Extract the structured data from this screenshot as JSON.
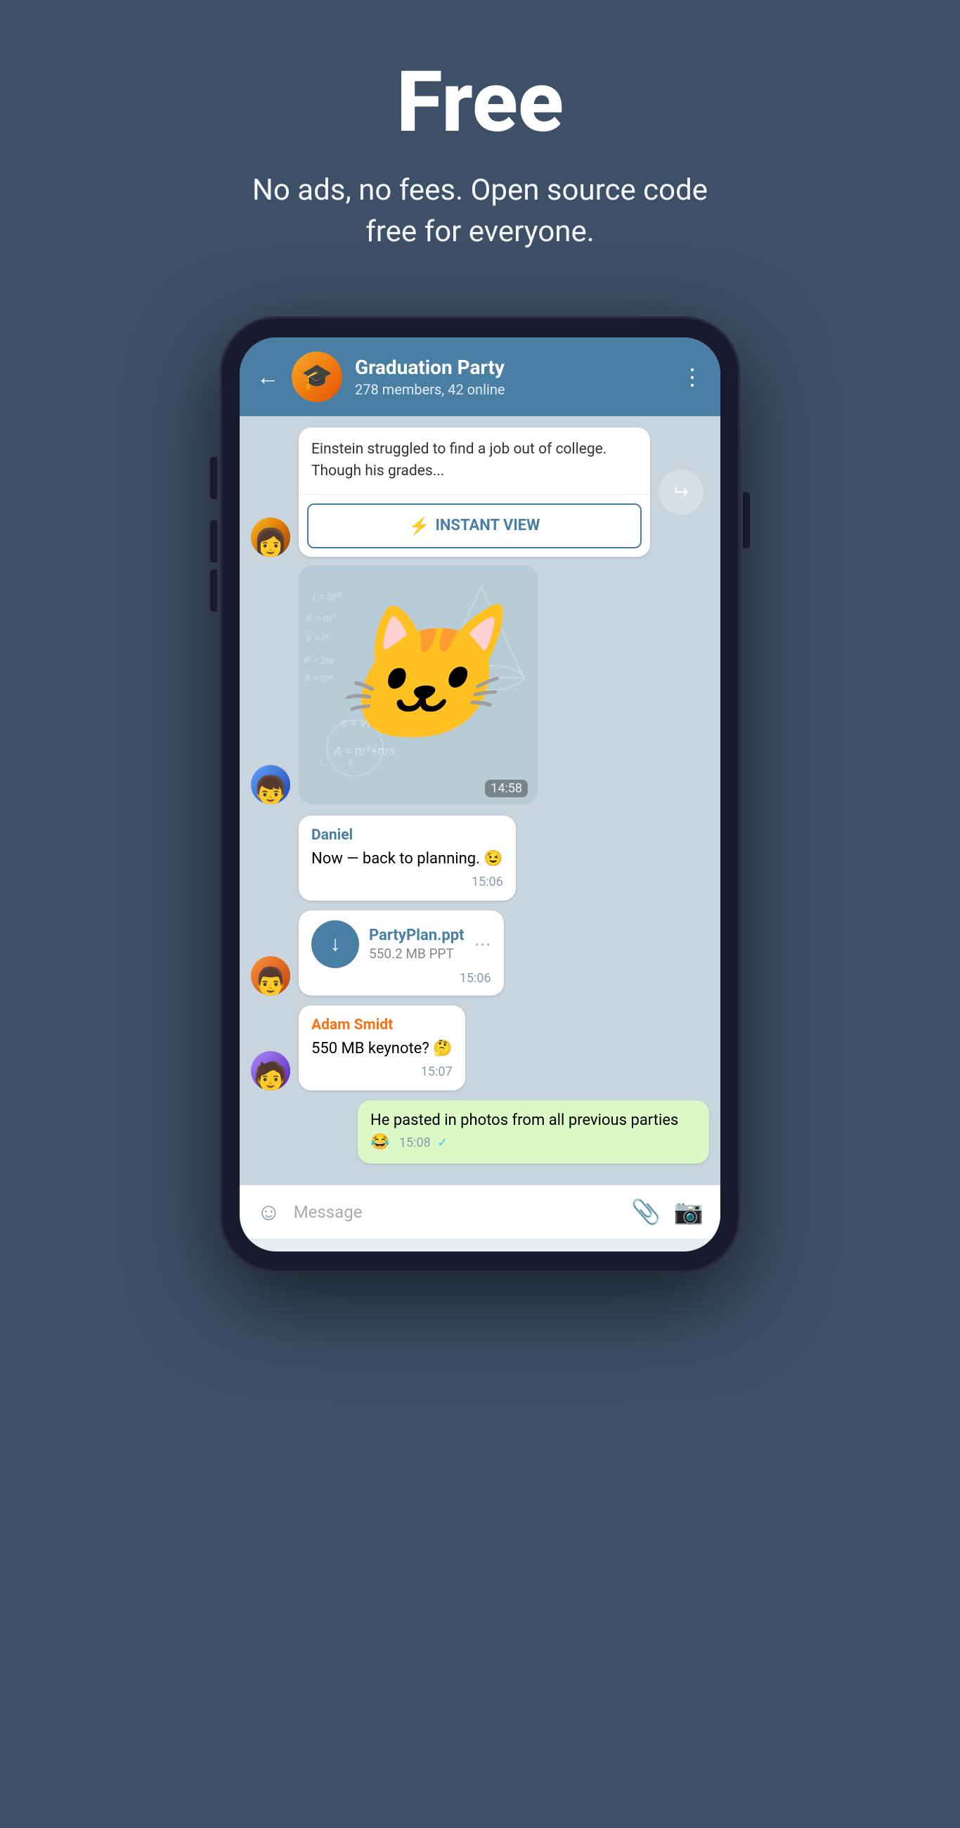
{
  "hero": {
    "title": "Free",
    "subtitle": "No ads, no fees. Open source code free for everyone."
  },
  "phone": {
    "header": {
      "back_label": "←",
      "group_name": "Graduation Party",
      "group_meta": "278 members, 42 online",
      "more_icon": "⋮"
    },
    "messages": [
      {
        "id": "msg-iv",
        "type": "instant_view",
        "avatar_class": "av-photo-amber",
        "article_text": "Einstein struggled to find a job out of college. Though his grades...",
        "iv_button_label": "INSTANT VIEW",
        "forward_icon": "↪"
      },
      {
        "id": "msg-sticker",
        "type": "sticker",
        "avatar_class": "av-photo-blue",
        "sticker_emoji": "🐱",
        "time": "14:58"
      },
      {
        "id": "msg-daniel",
        "type": "text",
        "sender": "Daniel",
        "sender_color": "blue",
        "text": "Now — back to planning. 😉",
        "time": "15:06"
      },
      {
        "id": "msg-file",
        "type": "file",
        "avatar_class": "av-photo-orange",
        "file_name": "PartyPlan.ppt",
        "file_size": "550.2 MB PPT",
        "time": "15:06",
        "download_icon": "↓"
      },
      {
        "id": "msg-adam",
        "type": "text",
        "sender": "Adam Smidt",
        "sender_color": "orange",
        "avatar_class": "av-photo-purple",
        "text": "550 MB keynote? 🤔",
        "time": "15:07"
      },
      {
        "id": "msg-own",
        "type": "text_own",
        "text": "He pasted in photos from all previous parties 😂",
        "time": "15:08",
        "tick": "✓"
      }
    ],
    "input_bar": {
      "emoji_icon": "☺",
      "placeholder": "Message",
      "attach_icon": "📎",
      "camera_icon": "📷"
    }
  }
}
